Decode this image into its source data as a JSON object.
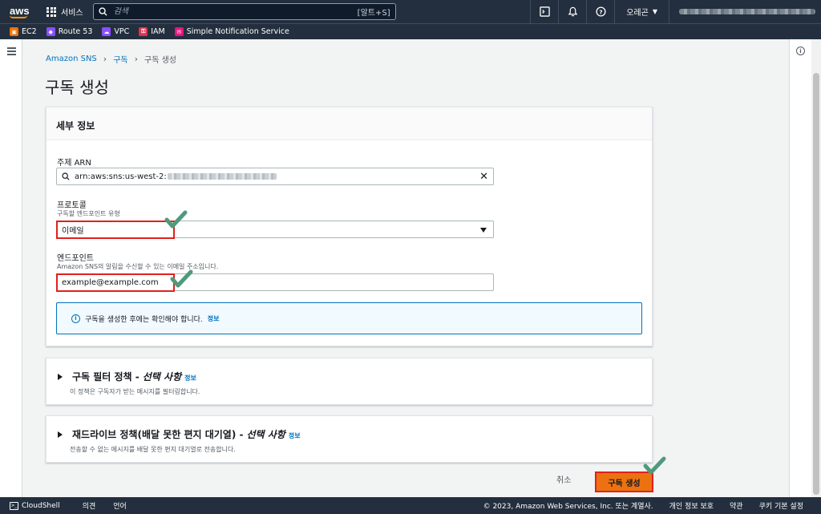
{
  "topnav": {
    "services_label": "서비스",
    "search_placeholder": "검색",
    "search_shortcut": "[알트+S]",
    "region_label": "오레곤"
  },
  "favorites": [
    {
      "label": "EC2",
      "color": "#ed7100"
    },
    {
      "label": "Route 53",
      "color": "#8c4fff"
    },
    {
      "label": "VPC",
      "color": "#8c4fff"
    },
    {
      "label": "IAM",
      "color": "#dd344c"
    },
    {
      "label": "Simple Notification Service",
      "color": "#e7157b"
    }
  ],
  "breadcrumb": {
    "root": "Amazon SNS",
    "parent": "구독",
    "current": "구독 생성"
  },
  "page": {
    "title": "구독 생성"
  },
  "details": {
    "header": "세부 정보",
    "topic_arn_label": "주제 ARN",
    "topic_arn_value": "arn:aws:sns:us-west-2:",
    "protocol_label": "프로토콜",
    "protocol_desc": "구독할 엔드포인트 유형",
    "protocol_value": "이메일",
    "endpoint_label": "엔드포인트",
    "endpoint_desc": "Amazon SNS의 알림을 수신할 수 있는 이메일 주소입니다.",
    "endpoint_value": "example@example.com",
    "alert_text": "구독을 생성한 후에는 확인해야 합니다.",
    "alert_link": "정보"
  },
  "filter_policy": {
    "title": "구독 필터 정책 -",
    "optional": "선택 사항",
    "info": "정보",
    "desc": "이 정책은 구독자가 받는 메시지를 필터링합니다."
  },
  "redrive_policy": {
    "title": "재드라이브 정책(배달 못한 편지 대기열) -",
    "optional": "선택 사항",
    "info": "정보",
    "desc": "전송할 수 없는 메시지를 배달 못한 편지 대기열로 전송합니다."
  },
  "actions": {
    "cancel": "취소",
    "create": "구독 생성"
  },
  "footer": {
    "cloudshell": "CloudShell",
    "feedback": "의견",
    "language": "언어",
    "copyright": "© 2023, Amazon Web Services, Inc. 또는 계열사.",
    "privacy": "개인 정보 보호",
    "terms": "약관",
    "cookies": "쿠키 기본 설정"
  },
  "colors": {
    "nav_bg": "#232f3e",
    "primary_button": "#ec7211",
    "highlight_box": "#e0211d",
    "checkmark": "#4f9a7c",
    "link": "#0073bb"
  }
}
